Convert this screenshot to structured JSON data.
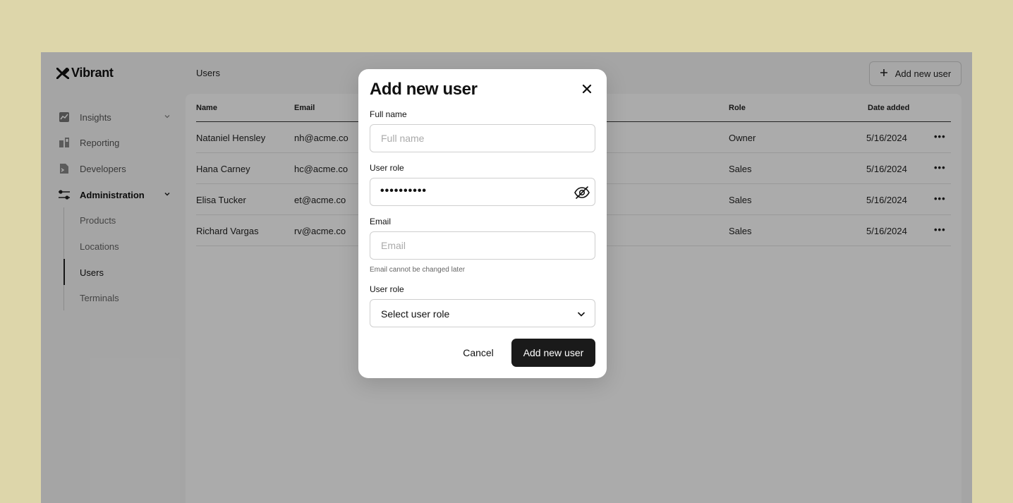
{
  "brand": {
    "name": "Vibrant"
  },
  "sidebar": {
    "items": [
      {
        "label": "Insights",
        "icon": "chart-line-icon",
        "expandable": true
      },
      {
        "label": "Reporting",
        "icon": "bar-chart-icon"
      },
      {
        "label": "Developers",
        "icon": "terminal-icon"
      },
      {
        "label": "Administration",
        "icon": "sliders-icon",
        "expandable": true,
        "expanded": true
      }
    ],
    "subitems": [
      {
        "label": "Products"
      },
      {
        "label": "Locations"
      },
      {
        "label": "Users",
        "active": true
      },
      {
        "label": "Terminals"
      }
    ]
  },
  "main": {
    "title": "Users",
    "add_button": "Add new user",
    "table": {
      "headers": {
        "name": "Name",
        "email": "Email",
        "role": "Role",
        "date": "Date added"
      },
      "rows": [
        {
          "name": "Nataniel Hensley",
          "email": "nh@acme.co",
          "role": "Owner",
          "date": "5/16/2024",
          "more": "•••"
        },
        {
          "name": "Hana Carney",
          "email": "hc@acme.co",
          "role": "Sales",
          "date": "5/16/2024",
          "more": "•••"
        },
        {
          "name": "Elisa Tucker",
          "email": "et@acme.co",
          "role": "Sales",
          "date": "5/16/2024",
          "more": "•••"
        },
        {
          "name": "Richard Vargas",
          "email": "rv@acme.co",
          "role": "Sales",
          "date": "5/16/2024",
          "more": "•••"
        }
      ]
    }
  },
  "modal": {
    "title": "Add new user",
    "full_name_label": "Full name",
    "full_name_placeholder": "Full name",
    "password_label": "User role",
    "password_value": "••••••••••",
    "email_label": "Email",
    "email_placeholder": "Email",
    "email_hint": "Email cannot be changed later",
    "role_label": "User role",
    "role_value": "Select user role",
    "cancel_label": "Cancel",
    "submit_label": "Add new user"
  }
}
